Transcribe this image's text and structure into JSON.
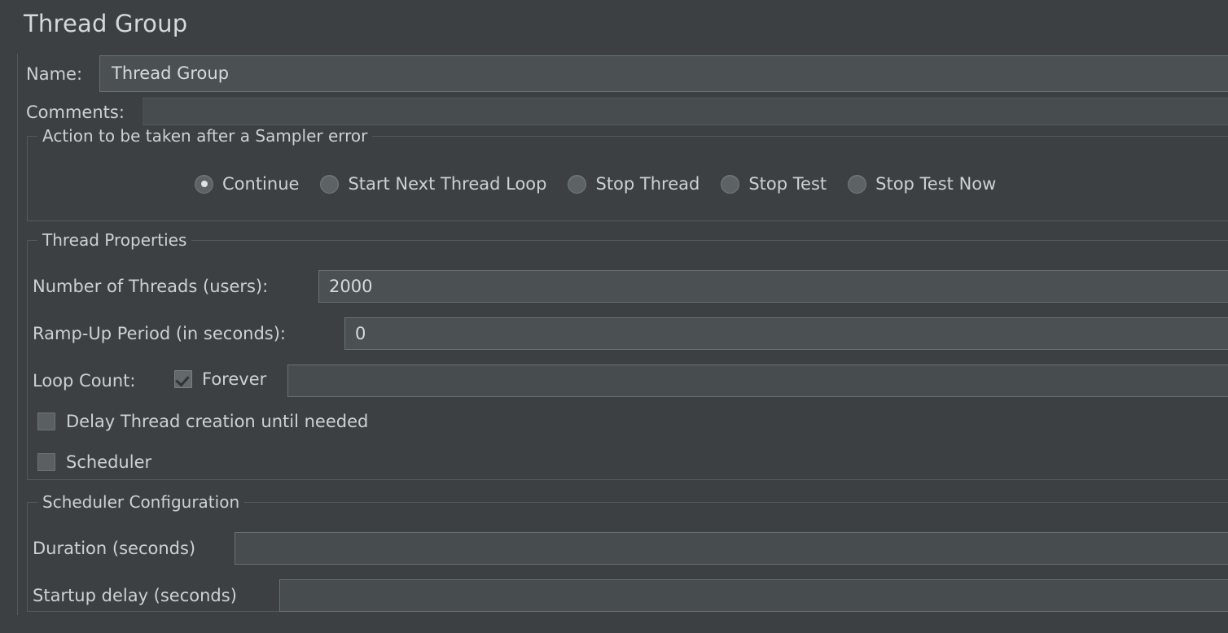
{
  "window": {
    "title": "Thread Group"
  },
  "identity": {
    "name_label": "Name:",
    "name_value": "Thread Group",
    "comments_label": "Comments:",
    "comments_value": ""
  },
  "sampler_error": {
    "legend": "Action to be taken after a Sampler error",
    "options": [
      {
        "label": "Continue",
        "selected": true
      },
      {
        "label": "Start Next Thread Loop",
        "selected": false
      },
      {
        "label": "Stop Thread",
        "selected": false
      },
      {
        "label": "Stop Test",
        "selected": false
      },
      {
        "label": "Stop Test Now",
        "selected": false
      }
    ]
  },
  "thread_properties": {
    "legend": "Thread Properties",
    "num_threads_label": "Number of Threads (users):",
    "num_threads_value": "2000",
    "ramp_up_label": "Ramp-Up Period (in seconds):",
    "ramp_up_value": "0",
    "loop_count_label": "Loop Count:",
    "loop_forever_label": "Forever",
    "loop_forever_checked": true,
    "loop_count_value": "",
    "delay_thread_label": "Delay Thread creation until needed",
    "delay_thread_checked": false,
    "scheduler_label": "Scheduler",
    "scheduler_checked": false
  },
  "scheduler_configuration": {
    "legend": "Scheduler Configuration",
    "duration_label": "Duration (seconds)",
    "duration_value": "",
    "startup_delay_label": "Startup delay (seconds)",
    "startup_delay_value": ""
  },
  "colors": {
    "background": "#3c4043",
    "field": "#4b5053",
    "field_disabled": "#474c4f",
    "border": "#6a6f72",
    "group_border": "#54595c",
    "text": "#cdd1d4"
  }
}
